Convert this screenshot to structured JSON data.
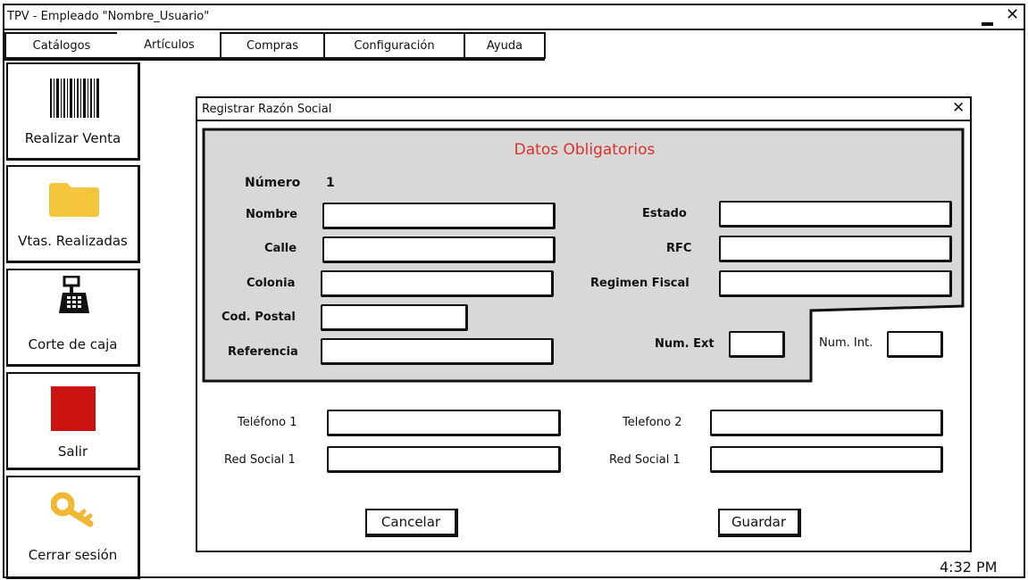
{
  "window": {
    "title": "TPV - Empleado \"Nombre_Usuario\"",
    "minimize_icon": "minimize-icon",
    "close_icon": "close-icon"
  },
  "menu": {
    "items": [
      "Catálogos",
      "Artículos",
      "Compras",
      "Configuración",
      "Ayuda"
    ]
  },
  "sidebar": {
    "items": [
      {
        "label": "Realizar Venta",
        "icon": "barcode-icon"
      },
      {
        "label": "Vtas. Realizadas",
        "icon": "folder-icon"
      },
      {
        "label": "Corte de caja",
        "icon": "cash-register-icon"
      },
      {
        "label": "Salir",
        "icon": "red-square-icon"
      },
      {
        "label": "Cerrar sesión",
        "icon": "key-icon"
      }
    ]
  },
  "dialog": {
    "title": "Registrar Razón Social",
    "close_icon": "close-icon",
    "section_title": "Datos Obligatorios",
    "numero_label": "Número",
    "numero_value": "1",
    "nombre_label": "Nombre",
    "calle_label": "Calle",
    "colonia_label": "Colonia",
    "cp_label": "Cod. Postal",
    "referencia_label": "Referencia",
    "estado_label": "Estado",
    "rfc_label": "RFC",
    "regimen_label": "Regimen Fiscal",
    "num_ext_label": "Num. Ext",
    "num_int_label": "Num. Int.",
    "telefono1_label": "Teléfono 1",
    "telefono2_label": "Telefono 2",
    "red_social1_label": "Red Social 1",
    "red_social2_label": "Red Social 1",
    "cancel_label": "Cancelar",
    "save_label": "Guardar"
  },
  "status": {
    "time": "4:32 PM"
  },
  "colors": {
    "section_title": "#d9312b",
    "panel_bg": "#d8d8d8",
    "folder": "#f4c63d",
    "exit": "#cc1111",
    "key": "#f2b731"
  }
}
